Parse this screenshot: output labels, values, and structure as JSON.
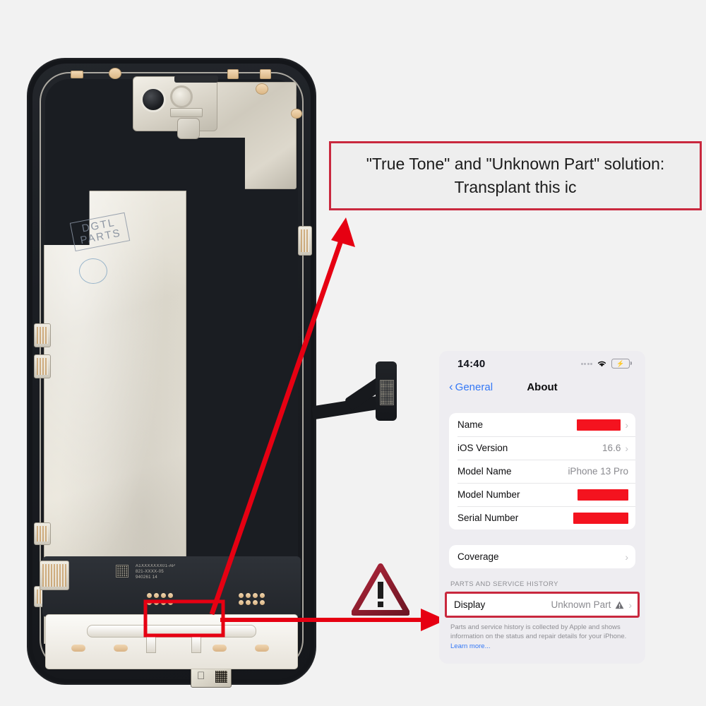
{
  "callout": {
    "line1": "\"True Tone\" and \"Unknown Part\" solution:",
    "line2": "Transplant this ic",
    "border_color": "#c9283e",
    "background_color": "#eeeeee"
  },
  "annotation": {
    "accent_color": "#e60012",
    "arrow_to_callout_name": "arrow-to-callout",
    "arrow_to_display_row_name": "arrow-to-display-row",
    "target_box_label": "transplant-ic-highlight",
    "warning_icon": "warning-triangle-icon"
  },
  "photo": {
    "watermark_line1": "DGTL",
    "watermark_line2": "PARTS",
    "board_print": "A1XXXXXXX01-AP\n821-XXXX-05\n940261 14",
    "ic_icon": "apple-logo-icon"
  },
  "ios": {
    "status_bar": {
      "time": "14:40",
      "signal_icon": "cellular-dots-icon",
      "wifi_icon": "wifi-icon",
      "battery_icon": "battery-charging-icon"
    },
    "nav": {
      "back_label": "General",
      "back_icon": "chevron-left-icon",
      "title": "About"
    },
    "device_rows": [
      {
        "label": "Name",
        "value": "",
        "redacted": true,
        "redact_width": "w1",
        "chevron": true
      },
      {
        "label": "iOS Version",
        "value": "16.6",
        "redacted": false,
        "chevron": true
      },
      {
        "label": "Model Name",
        "value": "iPhone 13 Pro",
        "redacted": false,
        "chevron": false
      },
      {
        "label": "Model Number",
        "value": "",
        "redacted": true,
        "redact_width": "w2",
        "chevron": false
      },
      {
        "label": "Serial Number",
        "value": "",
        "redacted": true,
        "redact_width": "w3",
        "chevron": false
      }
    ],
    "coverage_row": {
      "label": "Coverage",
      "value": "",
      "chevron": true
    },
    "parts_section_header": "PARTS AND SERVICE HISTORY",
    "display_row": {
      "label": "Display",
      "value": "Unknown Part",
      "warning_icon": "warning-triangle-icon",
      "chevron": true
    },
    "footnote": {
      "text": "Parts and service history is collected by Apple and shows information on the status and repair details for your iPhone. ",
      "link": "Learn more..."
    },
    "colors": {
      "accent_blue": "#3478f6",
      "redaction_red": "#f4131f",
      "panel_background": "#eeedf1"
    }
  }
}
